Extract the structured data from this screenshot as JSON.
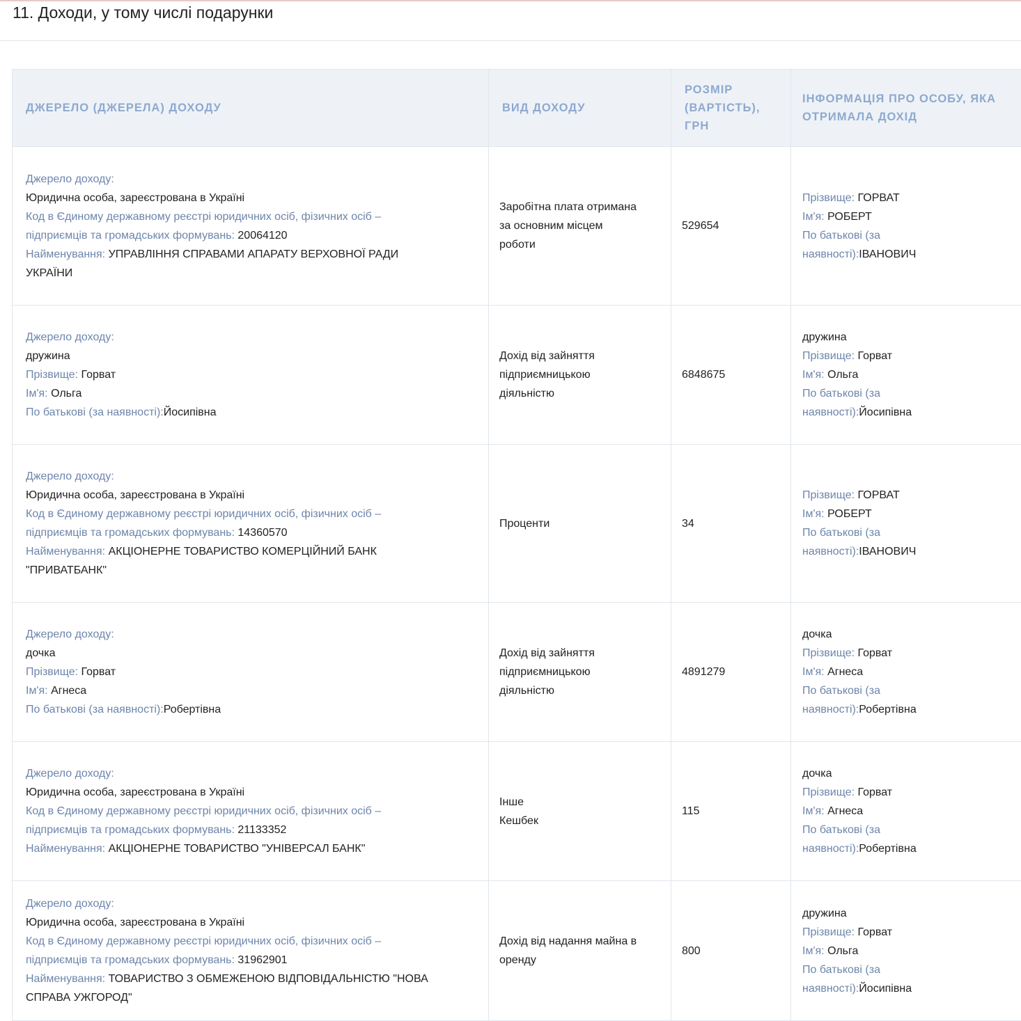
{
  "section": {
    "title": "11. Доходи, у тому числі подарунки"
  },
  "table": {
    "headers": {
      "source": "Джерело (джерела) доходу",
      "type": "Вид доходу",
      "amount_line1": "Розмір",
      "amount_line2": "(вартість),",
      "amount_line3": "грн",
      "recipient_line1": "Інформація про особу, яка",
      "recipient_line2": "отримала дохід"
    },
    "labels": {
      "source": "Джерело доходу:",
      "code_line1": "Код в Єдиному державному реєстрі юридичних осіб, фізичних осіб –",
      "code_line2": "підприємців та громадських формувань: ",
      "name": "Найменування: ",
      "surname": "Прізвище: ",
      "first_name": "Ім'я: ",
      "patronymic": "По батькові (за наявності):",
      "patronymic_line1": "По батькові (за",
      "patronymic_line2": "наявності):"
    },
    "rows": [
      {
        "source_type": "Юридична особа, зареєстрована в Україні",
        "code": "20064120",
        "name_line1": "УПРАВЛІННЯ СПРАВАМИ АПАРАТУ ВЕРХОВНОЇ РАДИ",
        "name_line2": "УКРАЇНИ",
        "type_lines": [
          "Заробітна плата отримана",
          "за основним місцем",
          "роботи"
        ],
        "amount": "529654",
        "recipient_relation": "",
        "recipient_surname": "ГОРВАТ",
        "recipient_first_name": "РОБЕРТ",
        "recipient_patronymic": "ІВАНОВИЧ"
      },
      {
        "source_relation": "дружина",
        "source_surname": "Горват",
        "source_first_name": "Ольга",
        "source_patronymic": "Йосипівна",
        "type_lines": [
          "Дохід від зайняття",
          "підприємницькою",
          "діяльністю"
        ],
        "amount": "6848675",
        "recipient_relation": "дружина",
        "recipient_surname": "Горват",
        "recipient_first_name": "Ольга",
        "recipient_patronymic": "Йосипівна"
      },
      {
        "source_type": "Юридична особа, зареєстрована в Україні",
        "code": "14360570",
        "name_line1": "АКЦІОНЕРНЕ ТОВАРИСТВО КОМЕРЦІЙНИЙ БАНК",
        "name_line2": "\"ПРИВАТБАНК\"",
        "type_lines": [
          "Проценти"
        ],
        "amount": "34",
        "recipient_relation": "",
        "recipient_surname": "ГОРВАТ",
        "recipient_first_name": "РОБЕРТ",
        "recipient_patronymic": "ІВАНОВИЧ"
      },
      {
        "source_relation": "дочка",
        "source_surname": "Горват",
        "source_first_name": "Агнеса",
        "source_patronymic": "Робертівна",
        "type_lines": [
          "Дохід від зайняття",
          "підприємницькою",
          "діяльністю"
        ],
        "amount": "4891279",
        "recipient_relation": "дочка",
        "recipient_surname": "Горват",
        "recipient_first_name": "Агнеса",
        "recipient_patronymic": "Робертівна"
      },
      {
        "source_type": "Юридична особа, зареєстрована в Україні",
        "code": "21133352",
        "name_line1": "АКЦІОНЕРНЕ ТОВАРИСТВО \"УНІВЕРСАЛ БАНК\"",
        "name_line2": "",
        "type_lines": [
          "Інше",
          "Кешбек"
        ],
        "amount": "115",
        "recipient_relation": "дочка",
        "recipient_surname": "Горват",
        "recipient_first_name": "Агнеса",
        "recipient_patronymic": "Робертівна"
      },
      {
        "source_type": "Юридична особа, зареєстрована в Україні",
        "code": "31962901",
        "name_line1": "ТОВАРИСТВО З ОБМЕЖЕНОЮ ВІДПОВІДАЛЬНІСТЮ \"НОВА",
        "name_line2": "СПРАВА УЖГОРОД\"",
        "type_lines": [
          "Дохід від надання майна в",
          "оренду"
        ],
        "amount": "800",
        "recipient_relation": "дружина",
        "recipient_surname": "Горват",
        "recipient_first_name": "Ольга",
        "recipient_patronymic": "Йосипівна"
      }
    ]
  }
}
